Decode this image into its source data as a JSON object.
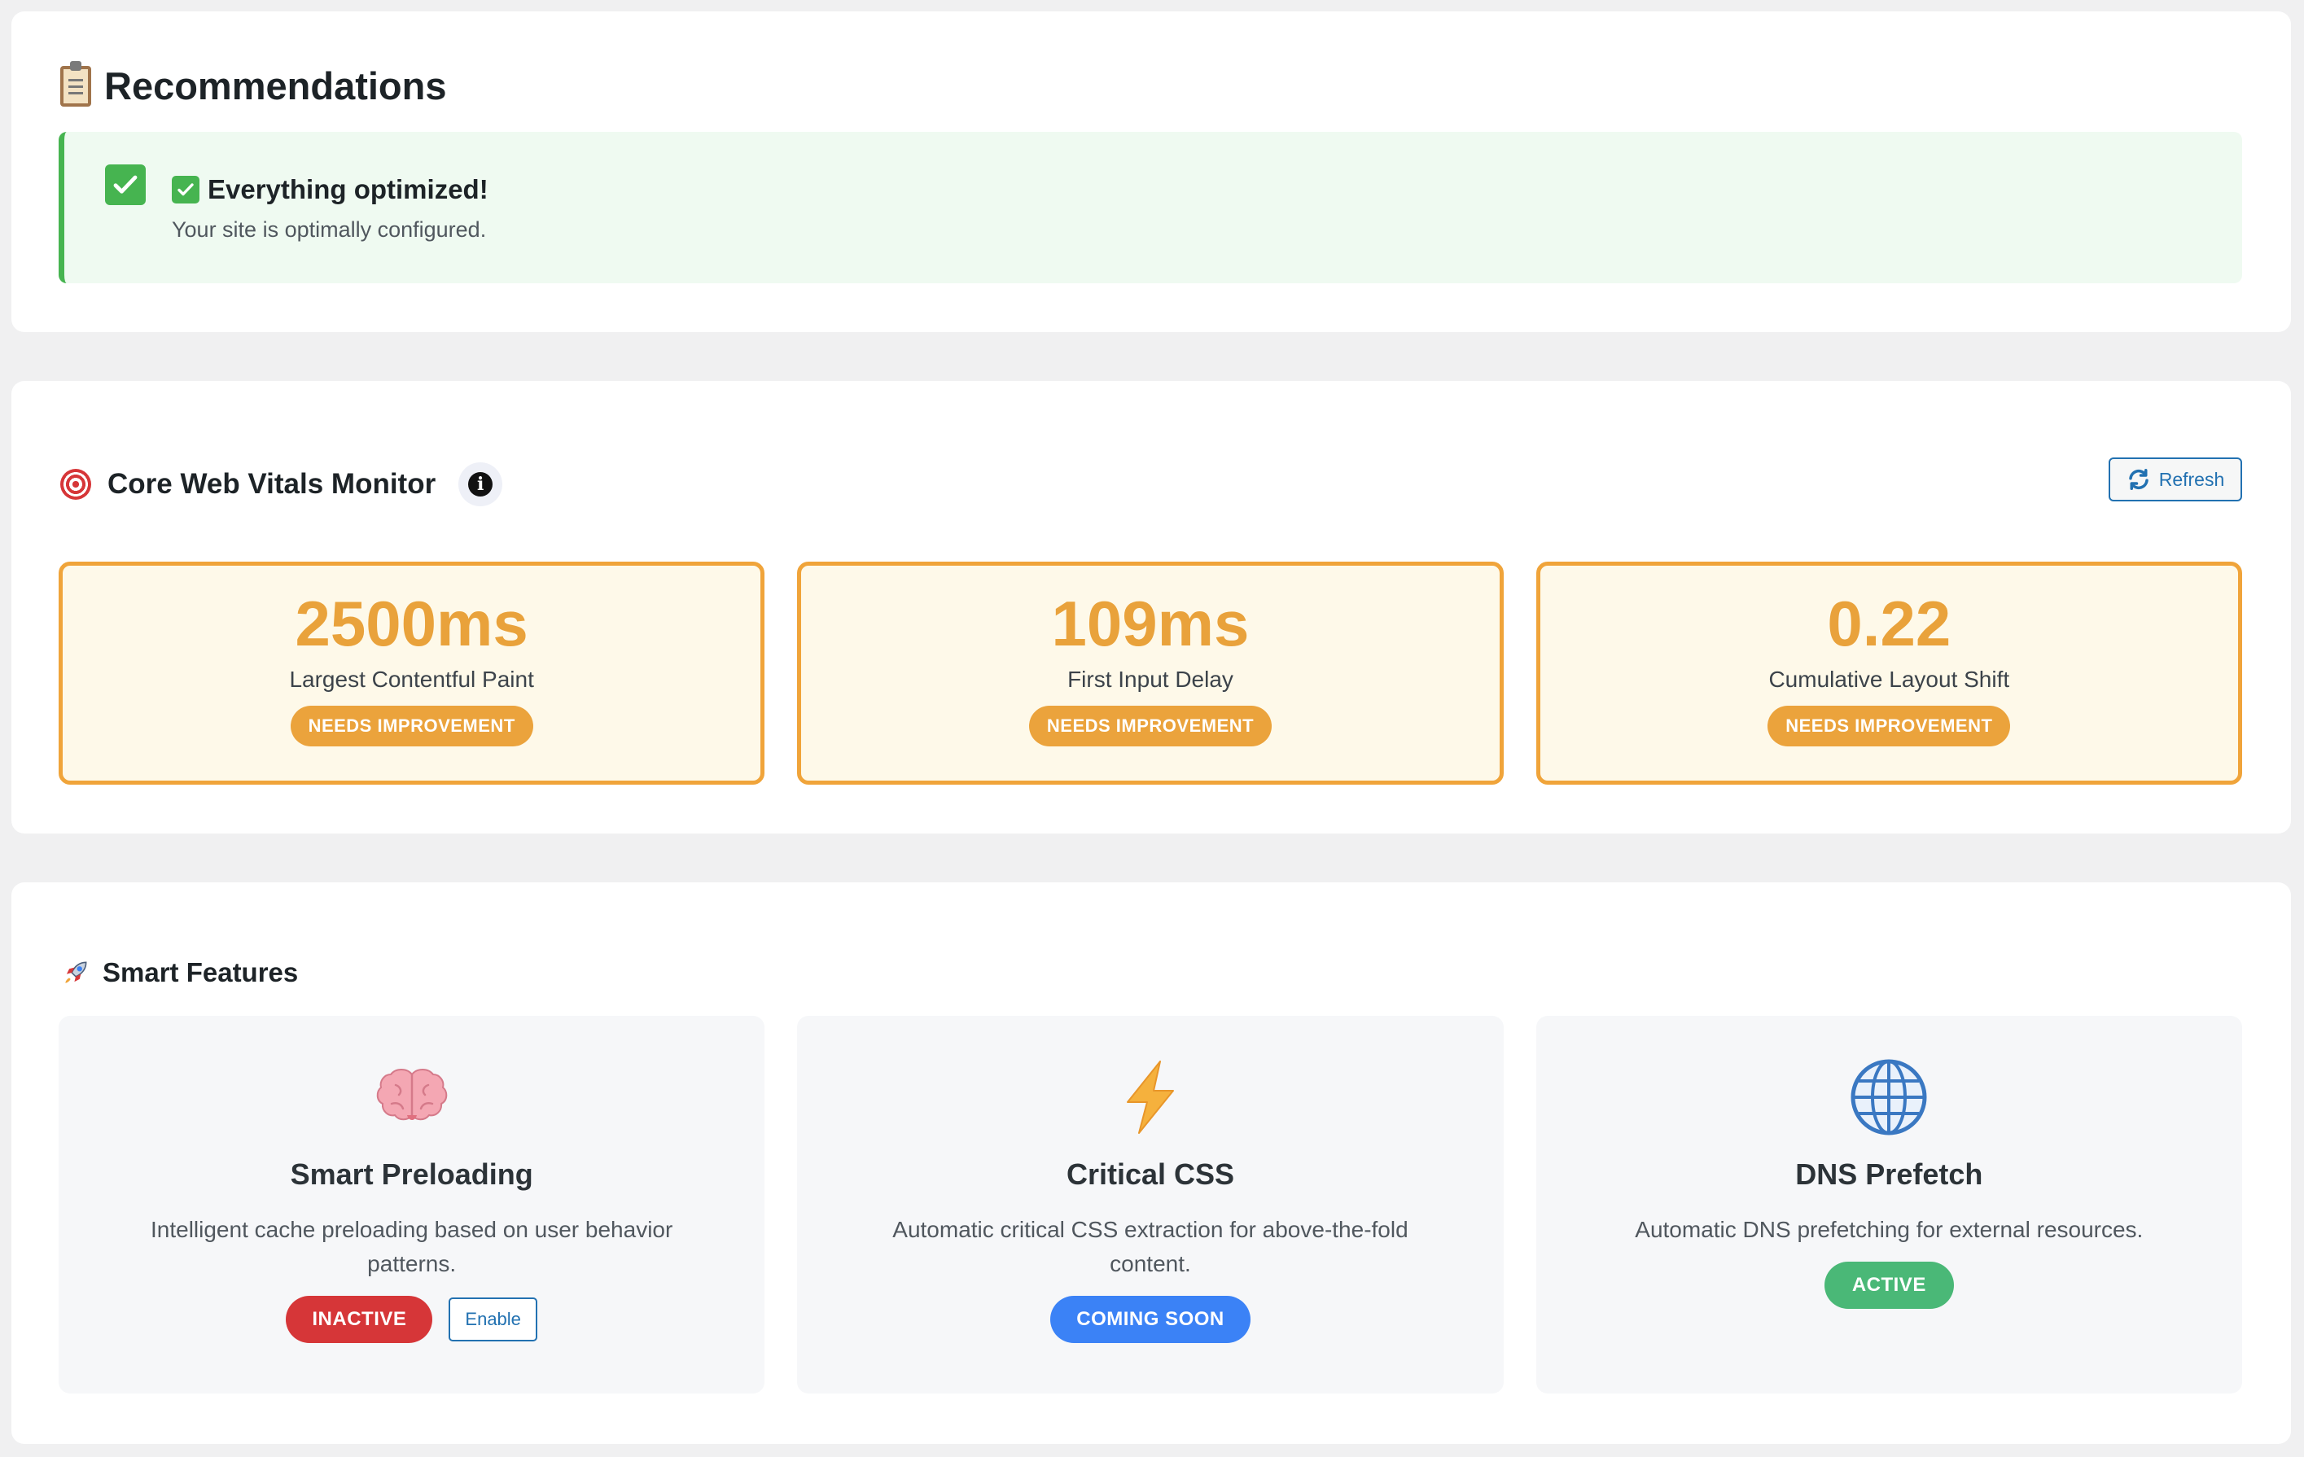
{
  "recommendations": {
    "title": "Recommendations",
    "title_icon": "clipboard-icon",
    "status": {
      "heading": "Everything optimized!",
      "message": "Your site is optimally configured.",
      "color": "#46b450"
    }
  },
  "vitals": {
    "title": "Core Web Vitals Monitor",
    "title_icon": "target-icon",
    "info_icon": "info-icon",
    "refresh_label": "Refresh",
    "metrics": [
      {
        "value": "2500ms",
        "label": "Largest Contentful Paint",
        "status": "NEEDS IMPROVEMENT"
      },
      {
        "value": "109ms",
        "label": "First Input Delay",
        "status": "NEEDS IMPROVEMENT"
      },
      {
        "value": "0.22",
        "label": "Cumulative Layout Shift",
        "status": "NEEDS IMPROVEMENT"
      }
    ],
    "status_color": "#eba33c"
  },
  "features": {
    "title": "Smart Features",
    "title_icon": "rocket-icon",
    "items": [
      {
        "icon": "brain-icon",
        "title": "Smart Preloading",
        "description": "Intelligent cache preloading based on user behavior patterns.",
        "status": "INACTIVE",
        "status_color": "#d63638",
        "action_label": "Enable"
      },
      {
        "icon": "lightning-icon",
        "title": "Critical CSS",
        "description": "Automatic critical CSS extraction for above-the-fold content.",
        "status": "COMING SOON",
        "status_color": "#3b82f6"
      },
      {
        "icon": "globe-icon",
        "title": "DNS Prefetch",
        "description": "Automatic DNS prefetching for external resources.",
        "status": "ACTIVE",
        "status_color": "#4ab877"
      }
    ]
  }
}
